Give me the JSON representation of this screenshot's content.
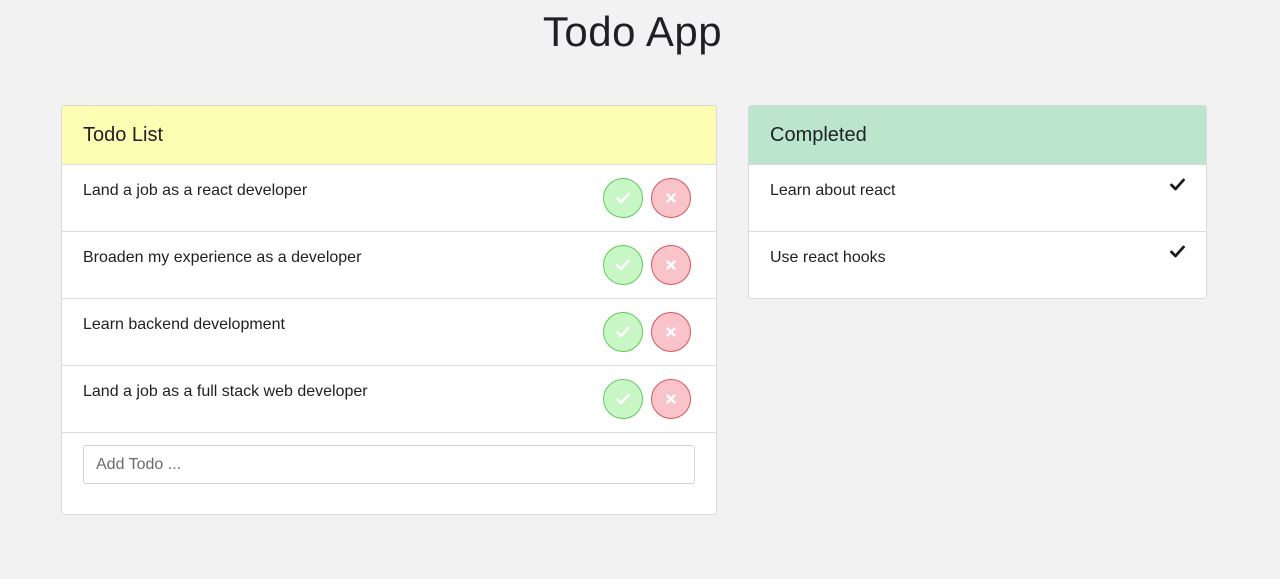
{
  "app": {
    "title": "Todo App"
  },
  "todo": {
    "header": "Todo List",
    "header_color": "#fdfdb4",
    "items": [
      {
        "label": "Land a job as a react developer"
      },
      {
        "label": "Broaden my experience as a developer"
      },
      {
        "label": "Learn backend development"
      },
      {
        "label": "Land a job as a full stack web developer"
      }
    ],
    "check_icon": "check-icon",
    "delete_icon": "close-icon",
    "add_placeholder": "Add Todo ..."
  },
  "completed": {
    "header": "Completed",
    "header_color": "#bbe6cd",
    "items": [
      {
        "label": "Learn about react"
      },
      {
        "label": "Use react hooks"
      }
    ],
    "done_icon": "check-icon"
  }
}
